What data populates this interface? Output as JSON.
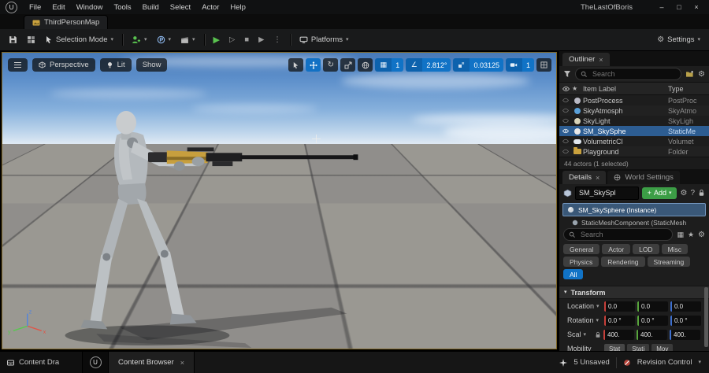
{
  "titlebar": {
    "logo": "U",
    "menu": [
      "File",
      "Edit",
      "Window",
      "Tools",
      "Build",
      "Select",
      "Actor",
      "Help"
    ],
    "title": "TheLastOfBoris",
    "minimize": "–",
    "maximize": "□",
    "close": "×"
  },
  "asset_tab": {
    "label": "ThirdPersonMap"
  },
  "toolbar": {
    "mode": "Selection Mode",
    "platforms": "Platforms",
    "settings": "Settings"
  },
  "viewport": {
    "perspective": "Perspective",
    "lit": "Lit",
    "show": "Show",
    "snap_grid": "1",
    "snap_angle": "2.812°",
    "snap_scale": "0.03125",
    "camera_speed": "1",
    "gizmo": {
      "x": "x",
      "y": "y",
      "z": "z"
    }
  },
  "outliner": {
    "title": "Outliner",
    "search_placeholder": "Search",
    "col_label": "Item Label",
    "col_type": "Type",
    "rows": [
      {
        "label": "PostProcess",
        "type": "PostProc"
      },
      {
        "label": "SkyAtmosph",
        "type": "SkyAtmo"
      },
      {
        "label": "SkyLight",
        "type": "SkyLigh"
      },
      {
        "label": "SM_SkySphe",
        "type": "StaticMe"
      },
      {
        "label": "VolumetricCl",
        "type": "Volumet"
      },
      {
        "label": "Playground",
        "type": "Folder"
      }
    ],
    "status": "44 actors (1 selected)"
  },
  "details": {
    "tab_details": "Details",
    "tab_world": "World Settings",
    "name_value": "SM_SkySpl",
    "add_label": "Add",
    "help": "?",
    "instance": "SM_SkySphere (Instance)",
    "component": "StaticMeshComponent (StaticMesh",
    "search_placeholder": "Search",
    "filters": [
      "General",
      "Actor",
      "LOD",
      "Misc",
      "Physics",
      "Rendering",
      "Streaming"
    ],
    "filter_all": "All",
    "transform": {
      "title": "Transform",
      "location_label": "Location",
      "rotation_label": "Rotation",
      "scale_label": "Scal",
      "mobility_label": "Mobility",
      "location": [
        "0.0",
        "0.0",
        "0.0"
      ],
      "rotation": [
        "0.0 °",
        "0.0 °",
        "0.0 °"
      ],
      "scale": [
        "400.",
        "400.",
        "400."
      ],
      "mobility": [
        "Stat",
        "Stati",
        "Mov"
      ]
    }
  },
  "statusbar": {
    "content_drawer": "Content Dra",
    "content_browser": "Content Browser",
    "unsaved": "5 Unsaved",
    "revision": "Revision Control"
  },
  "icons": {
    "chevron": "▾",
    "close": "×",
    "gear": "⚙",
    "star": "★",
    "kebab": "⋮",
    "play": "▶",
    "play_outline": "▷",
    "stop": "■",
    "grid": "▦",
    "angle": "∠",
    "rotate": "↻",
    "plus": "+"
  },
  "colors": {
    "accent_blue": "#1173c6",
    "accent_green": "#3c9e46",
    "selection": "#2d5d92",
    "viewport_border": "#7e6524"
  }
}
